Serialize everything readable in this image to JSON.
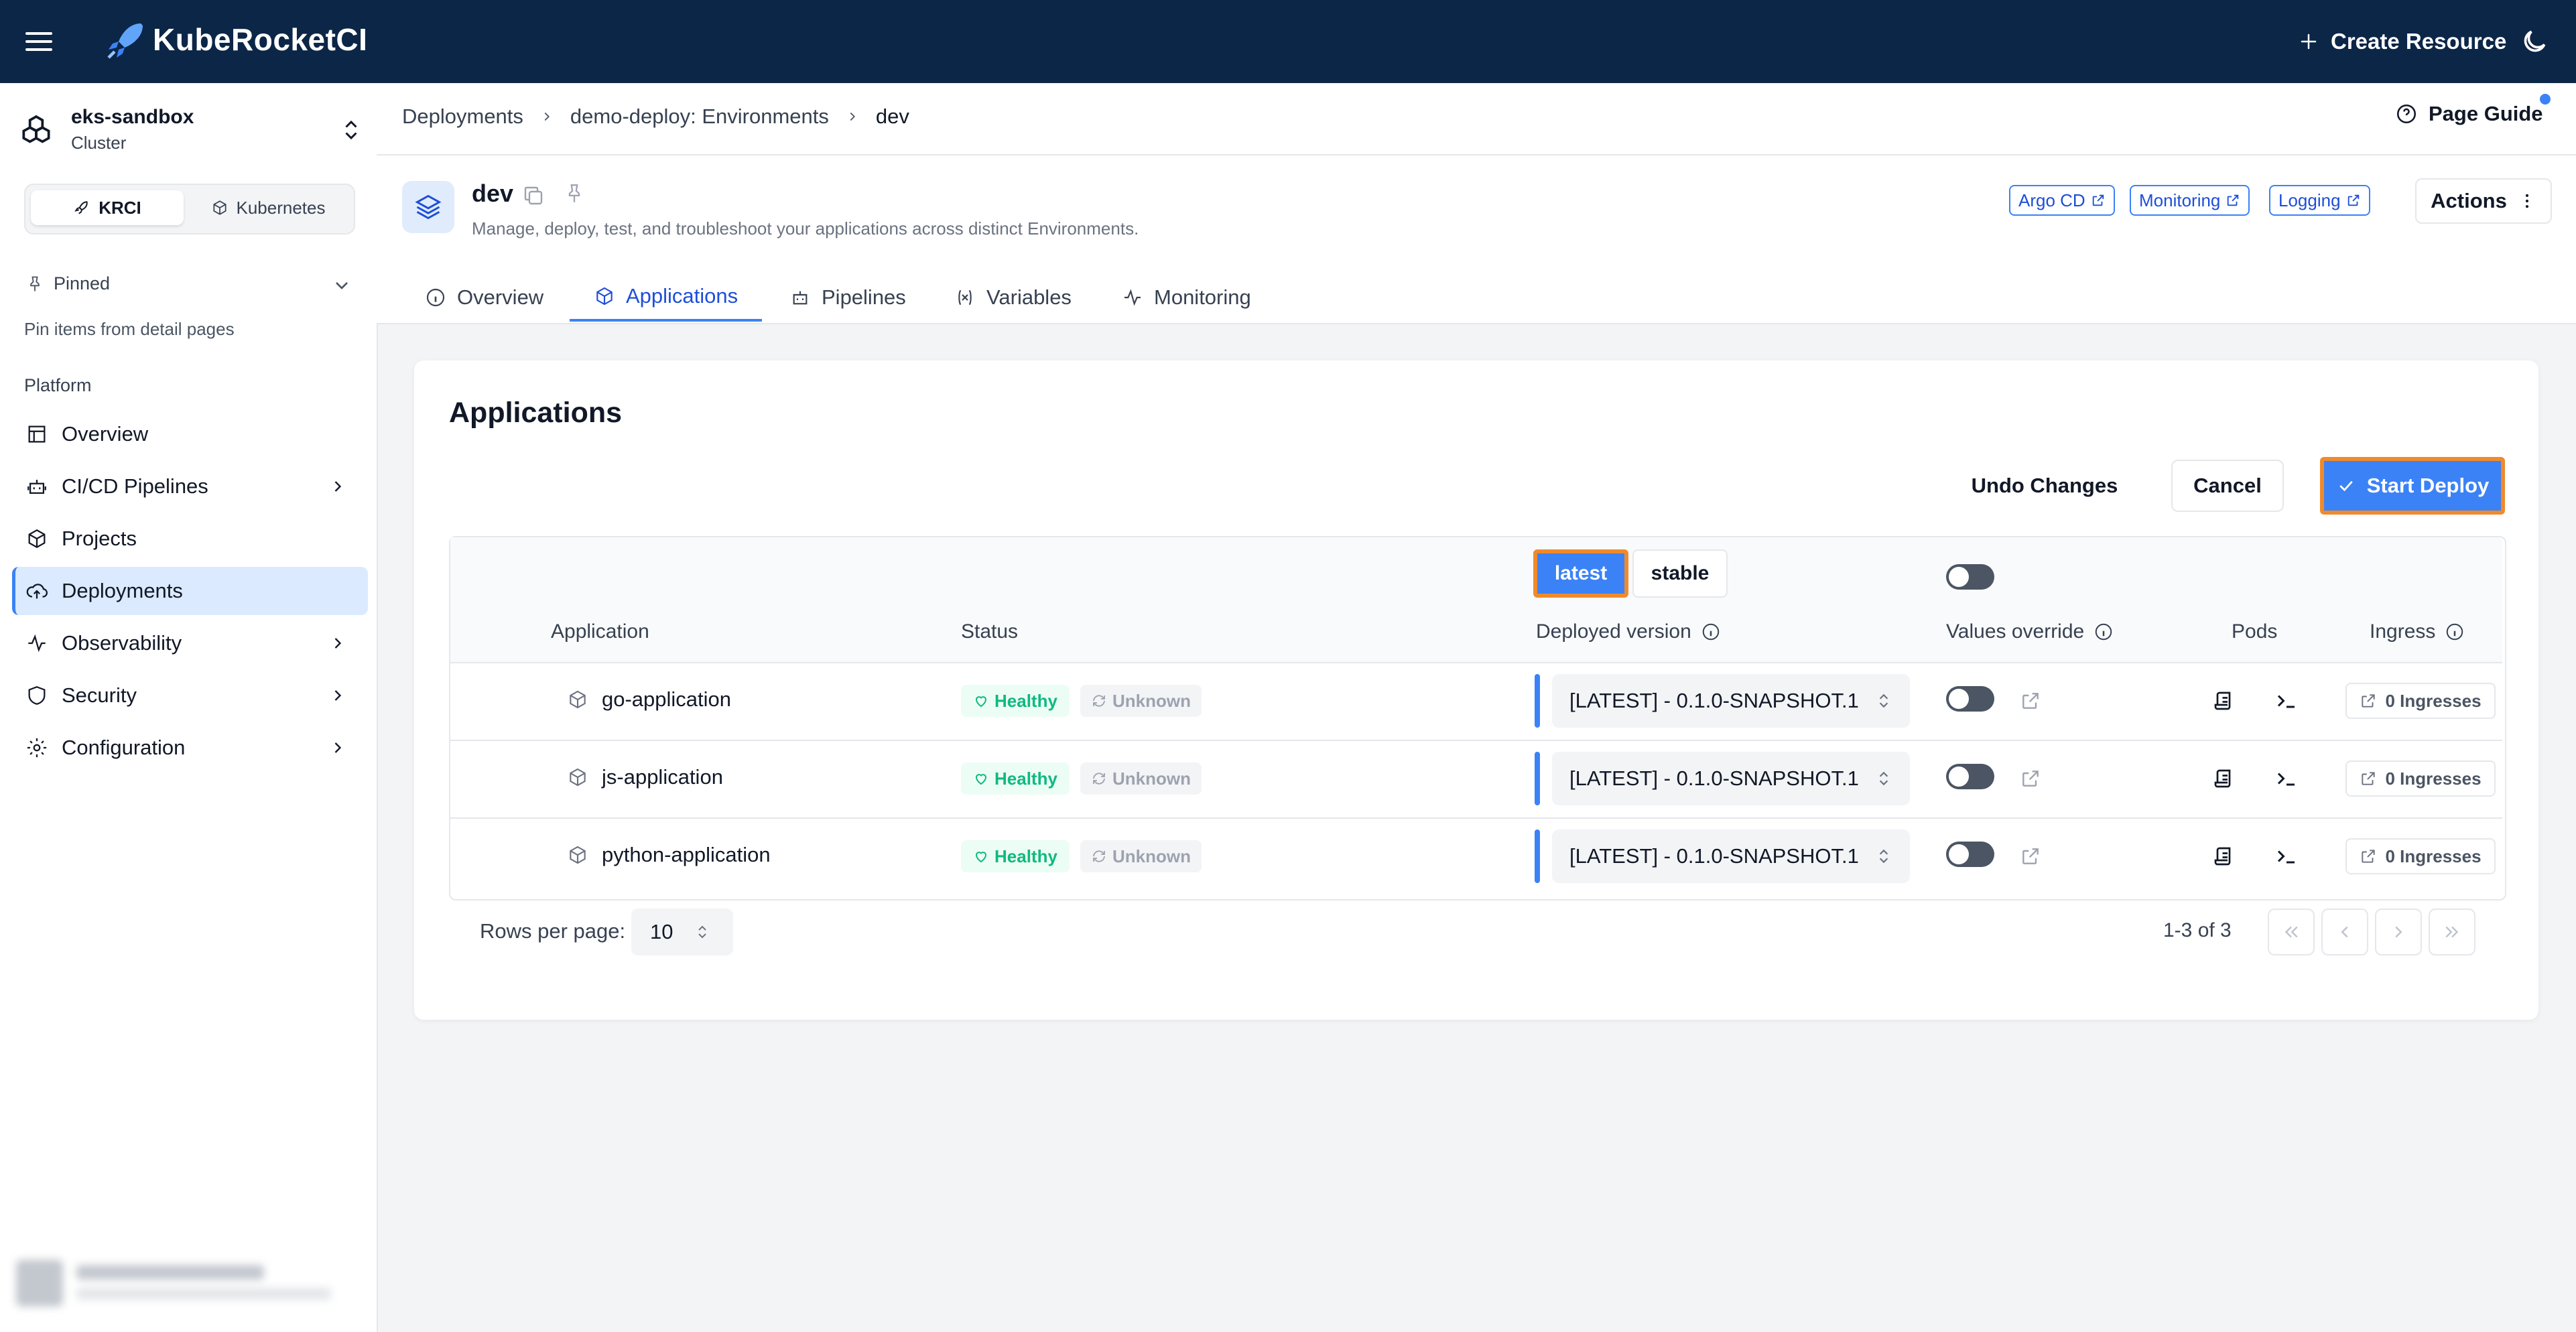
{
  "app": {
    "brand": "KubeRocketCI",
    "create_resource": "Create Resource"
  },
  "cluster": {
    "name": "eks-sandbox",
    "type": "Cluster"
  },
  "mode": {
    "krci": "KRCI",
    "kubernetes": "Kubernetes"
  },
  "pinned": {
    "label": "Pinned",
    "hint": "Pin items from detail pages"
  },
  "sidebar": {
    "section": "Platform",
    "items": [
      {
        "label": "Overview",
        "icon": "layout-icon"
      },
      {
        "label": "CI/CD Pipelines",
        "icon": "bot-icon"
      },
      {
        "label": "Projects",
        "icon": "box-icon"
      },
      {
        "label": "Deployments",
        "icon": "cloud-upload-icon"
      },
      {
        "label": "Observability",
        "icon": "activity-icon"
      },
      {
        "label": "Security",
        "icon": "shield-icon"
      },
      {
        "label": "Configuration",
        "icon": "gear-icon"
      }
    ]
  },
  "breadcrumb": [
    "Deployments",
    "demo-deploy: Environments",
    "dev"
  ],
  "page_guide": "Page Guide",
  "env": {
    "title": "dev",
    "description": "Manage, deploy, test, and troubleshoot your applications across distinct Environments.",
    "links": [
      "Argo CD",
      "Monitoring",
      "Logging"
    ],
    "actions": "Actions"
  },
  "tabs": [
    "Overview",
    "Applications",
    "Pipelines",
    "Variables",
    "Monitoring"
  ],
  "card": {
    "title": "Applications",
    "undo": "Undo Changes",
    "cancel": "Cancel",
    "deploy": "Start Deploy"
  },
  "table": {
    "presets": {
      "latest": "latest",
      "stable": "stable"
    },
    "headers": {
      "application": "Application",
      "status": "Status",
      "deployed_version": "Deployed version",
      "values_override": "Values override",
      "pods": "Pods",
      "ingress": "Ingress"
    },
    "rows": [
      {
        "name": "go-application",
        "health": "Healthy",
        "sync": "Unknown",
        "version": "[LATEST] - 0.1.0-SNAPSHOT.1",
        "ingress": "0 Ingresses"
      },
      {
        "name": "js-application",
        "health": "Healthy",
        "sync": "Unknown",
        "version": "[LATEST] - 0.1.0-SNAPSHOT.1",
        "ingress": "0 Ingresses"
      },
      {
        "name": "python-application",
        "health": "Healthy",
        "sync": "Unknown",
        "version": "[LATEST] - 0.1.0-SNAPSHOT.1",
        "ingress": "0 Ingresses"
      }
    ]
  },
  "pagination": {
    "rows_label": "Rows per page:",
    "rows_value": "10",
    "range": "1-3 of 3"
  },
  "colors": {
    "topbar": "#0c2647",
    "accent": "#3b82f6",
    "highlight": "#f08a2c",
    "healthy": "#10b981"
  }
}
